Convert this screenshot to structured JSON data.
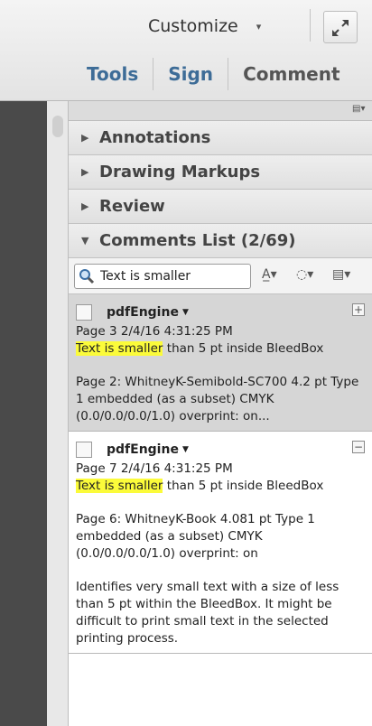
{
  "toolbar": {
    "customize_label": "Customize",
    "caret": "▾",
    "tabs": [
      "Tools",
      "Sign",
      "Comment"
    ]
  },
  "sections": [
    {
      "label": "Annotations",
      "expanded": false
    },
    {
      "label": "Drawing Markups",
      "expanded": false
    },
    {
      "label": "Review",
      "expanded": false
    },
    {
      "label": "Comments List (2/69)",
      "expanded": true
    }
  ],
  "search": {
    "value": "Text is smaller"
  },
  "comments": [
    {
      "author": "pdfEngine",
      "meta": "Page 3  2/4/16 4:31:25 PM",
      "highlight": "Text is smaller",
      "rest": " than 5 pt inside BleedBox",
      "details": [
        "Page 2: WhitneyK-Semibold-SC700 4.2 pt Type 1  embedded (as a subset) CMYK (0.0/0.0/0.0/1.0)  overprint: on..."
      ],
      "toggle": "+"
    },
    {
      "author": "pdfEngine",
      "meta": "Page 7  2/4/16 4:31:25 PM",
      "highlight": "Text is smaller",
      "rest": " than 5 pt inside BleedBox",
      "details": [
        "Page 6: WhitneyK-Book 4.081 pt Type 1 embedded (as a subset) CMYK (0.0/0.0/0.0/1.0)  overprint: on",
        "Identifies very small text with a size of less than 5 pt within the BleedBox. It might be difficult to print small text in the selected printing process."
      ],
      "toggle": "−"
    }
  ],
  "colors": {
    "accent": "#3d6c97",
    "highlight": "#fbfb3a",
    "selected_row": "#d6d6d6"
  }
}
